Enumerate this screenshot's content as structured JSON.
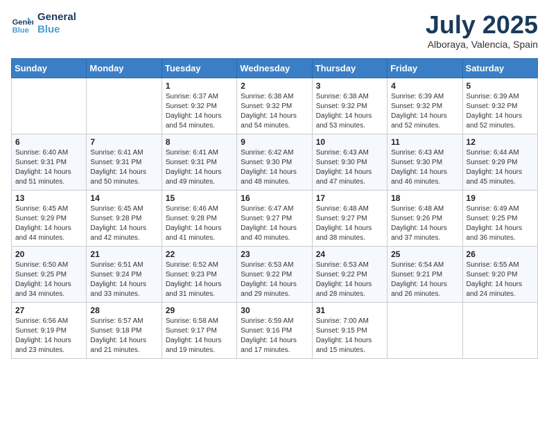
{
  "header": {
    "logo_line1": "General",
    "logo_line2": "Blue",
    "month_year": "July 2025",
    "location": "Alboraya, Valencia, Spain"
  },
  "weekdays": [
    "Sunday",
    "Monday",
    "Tuesday",
    "Wednesday",
    "Thursday",
    "Friday",
    "Saturday"
  ],
  "weeks": [
    [
      {
        "day": "",
        "info": ""
      },
      {
        "day": "",
        "info": ""
      },
      {
        "day": "1",
        "info": "Sunrise: 6:37 AM\nSunset: 9:32 PM\nDaylight: 14 hours and 54 minutes."
      },
      {
        "day": "2",
        "info": "Sunrise: 6:38 AM\nSunset: 9:32 PM\nDaylight: 14 hours and 54 minutes."
      },
      {
        "day": "3",
        "info": "Sunrise: 6:38 AM\nSunset: 9:32 PM\nDaylight: 14 hours and 53 minutes."
      },
      {
        "day": "4",
        "info": "Sunrise: 6:39 AM\nSunset: 9:32 PM\nDaylight: 14 hours and 52 minutes."
      },
      {
        "day": "5",
        "info": "Sunrise: 6:39 AM\nSunset: 9:32 PM\nDaylight: 14 hours and 52 minutes."
      }
    ],
    [
      {
        "day": "6",
        "info": "Sunrise: 6:40 AM\nSunset: 9:31 PM\nDaylight: 14 hours and 51 minutes."
      },
      {
        "day": "7",
        "info": "Sunrise: 6:41 AM\nSunset: 9:31 PM\nDaylight: 14 hours and 50 minutes."
      },
      {
        "day": "8",
        "info": "Sunrise: 6:41 AM\nSunset: 9:31 PM\nDaylight: 14 hours and 49 minutes."
      },
      {
        "day": "9",
        "info": "Sunrise: 6:42 AM\nSunset: 9:30 PM\nDaylight: 14 hours and 48 minutes."
      },
      {
        "day": "10",
        "info": "Sunrise: 6:43 AM\nSunset: 9:30 PM\nDaylight: 14 hours and 47 minutes."
      },
      {
        "day": "11",
        "info": "Sunrise: 6:43 AM\nSunset: 9:30 PM\nDaylight: 14 hours and 46 minutes."
      },
      {
        "day": "12",
        "info": "Sunrise: 6:44 AM\nSunset: 9:29 PM\nDaylight: 14 hours and 45 minutes."
      }
    ],
    [
      {
        "day": "13",
        "info": "Sunrise: 6:45 AM\nSunset: 9:29 PM\nDaylight: 14 hours and 44 minutes."
      },
      {
        "day": "14",
        "info": "Sunrise: 6:45 AM\nSunset: 9:28 PM\nDaylight: 14 hours and 42 minutes."
      },
      {
        "day": "15",
        "info": "Sunrise: 6:46 AM\nSunset: 9:28 PM\nDaylight: 14 hours and 41 minutes."
      },
      {
        "day": "16",
        "info": "Sunrise: 6:47 AM\nSunset: 9:27 PM\nDaylight: 14 hours and 40 minutes."
      },
      {
        "day": "17",
        "info": "Sunrise: 6:48 AM\nSunset: 9:27 PM\nDaylight: 14 hours and 38 minutes."
      },
      {
        "day": "18",
        "info": "Sunrise: 6:48 AM\nSunset: 9:26 PM\nDaylight: 14 hours and 37 minutes."
      },
      {
        "day": "19",
        "info": "Sunrise: 6:49 AM\nSunset: 9:25 PM\nDaylight: 14 hours and 36 minutes."
      }
    ],
    [
      {
        "day": "20",
        "info": "Sunrise: 6:50 AM\nSunset: 9:25 PM\nDaylight: 14 hours and 34 minutes."
      },
      {
        "day": "21",
        "info": "Sunrise: 6:51 AM\nSunset: 9:24 PM\nDaylight: 14 hours and 33 minutes."
      },
      {
        "day": "22",
        "info": "Sunrise: 6:52 AM\nSunset: 9:23 PM\nDaylight: 14 hours and 31 minutes."
      },
      {
        "day": "23",
        "info": "Sunrise: 6:53 AM\nSunset: 9:22 PM\nDaylight: 14 hours and 29 minutes."
      },
      {
        "day": "24",
        "info": "Sunrise: 6:53 AM\nSunset: 9:22 PM\nDaylight: 14 hours and 28 minutes."
      },
      {
        "day": "25",
        "info": "Sunrise: 6:54 AM\nSunset: 9:21 PM\nDaylight: 14 hours and 26 minutes."
      },
      {
        "day": "26",
        "info": "Sunrise: 6:55 AM\nSunset: 9:20 PM\nDaylight: 14 hours and 24 minutes."
      }
    ],
    [
      {
        "day": "27",
        "info": "Sunrise: 6:56 AM\nSunset: 9:19 PM\nDaylight: 14 hours and 23 minutes."
      },
      {
        "day": "28",
        "info": "Sunrise: 6:57 AM\nSunset: 9:18 PM\nDaylight: 14 hours and 21 minutes."
      },
      {
        "day": "29",
        "info": "Sunrise: 6:58 AM\nSunset: 9:17 PM\nDaylight: 14 hours and 19 minutes."
      },
      {
        "day": "30",
        "info": "Sunrise: 6:59 AM\nSunset: 9:16 PM\nDaylight: 14 hours and 17 minutes."
      },
      {
        "day": "31",
        "info": "Sunrise: 7:00 AM\nSunset: 9:15 PM\nDaylight: 14 hours and 15 minutes."
      },
      {
        "day": "",
        "info": ""
      },
      {
        "day": "",
        "info": ""
      }
    ]
  ]
}
